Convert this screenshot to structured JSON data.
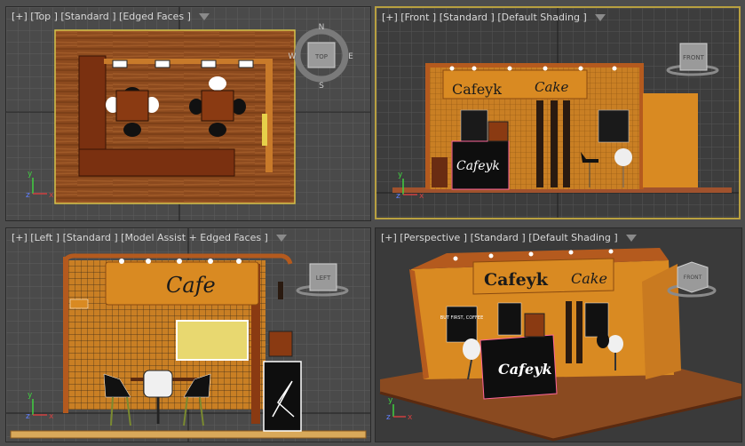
{
  "viewports": {
    "top": {
      "label": "[+] [Top ] [Standard ] [Edged Faces ]"
    },
    "front": {
      "label": "[+] [Front ] [Standard ] [Default Shading ]"
    },
    "left": {
      "label": "[+] [Left ] [Standard ] [Model Assist + Edged Faces ]"
    },
    "perspective": {
      "label": "[+] [Perspective ] [Standard ] [Default Shading ]"
    }
  },
  "viewcube": {
    "top_face": "TOP",
    "front_face": "FRONT",
    "left_face": "LEFT",
    "compass": {
      "n": "N",
      "s": "S",
      "e": "E",
      "w": "W"
    }
  },
  "axes": {
    "x": "x",
    "y": "y",
    "z": "z"
  },
  "signage": {
    "front_brand": "Cafeyk",
    "front_cake": "Cake",
    "counter_brand": "Cafeyk",
    "left_brand": "Cafe",
    "persp_brand": "Cafeyk",
    "persp_cake": "Cake",
    "persp_counter": "Cafeyk",
    "poster_text": "BUT FIRST, COFFEE"
  },
  "colors": {
    "wood_floor": "#8a4a20",
    "booth_orange": "#d98a22",
    "dark_wood": "#6a2c12",
    "grid": "#6a6a6a",
    "active_border": "#b8a040",
    "sign_text": "#1a1a1a"
  }
}
